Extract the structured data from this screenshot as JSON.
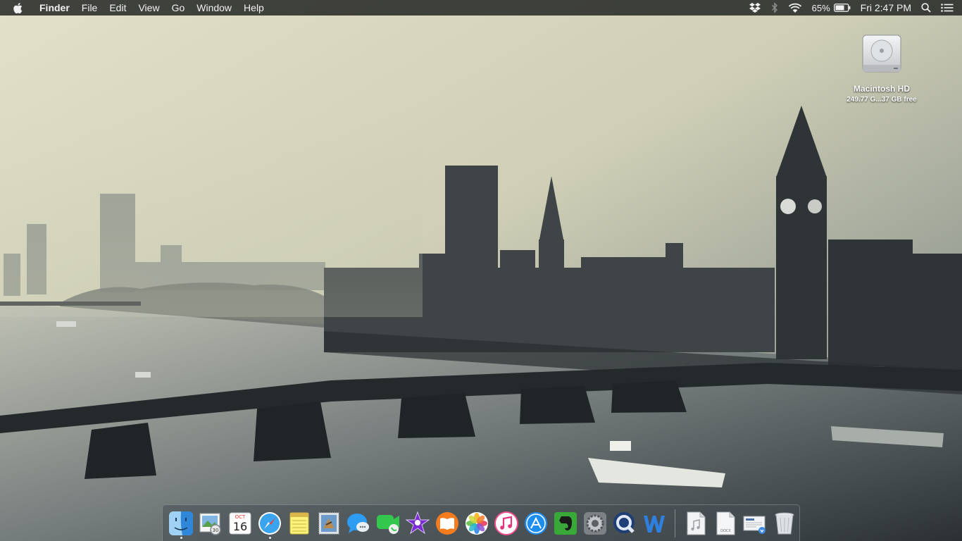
{
  "menubar": {
    "app_name": "Finder",
    "menus": [
      "File",
      "Edit",
      "View",
      "Go",
      "Window",
      "Help"
    ],
    "battery_percent": "65%",
    "clock": "Fri 2:47 PM",
    "status_icons": [
      "dropbox-icon",
      "bluetooth-icon",
      "wifi-icon",
      "battery-icon",
      "spotlight-icon",
      "notification-center-icon"
    ]
  },
  "desktop": {
    "hd_name": "Macintosh HD",
    "hd_subtitle": "249.77 G...37 GB free"
  },
  "dock": {
    "apps": [
      {
        "icon": "finder-icon",
        "running": true
      },
      {
        "icon": "preview-icon",
        "running": false
      },
      {
        "icon": "calendar-icon",
        "running": false,
        "month": "OCT",
        "day": "16"
      },
      {
        "icon": "safari-icon",
        "running": true
      },
      {
        "icon": "notes-icon",
        "running": false
      },
      {
        "icon": "mail-stamp-icon",
        "running": false
      },
      {
        "icon": "messages-icon",
        "running": false
      },
      {
        "icon": "facetime-icon",
        "running": false
      },
      {
        "icon": "imovie-icon",
        "running": false
      },
      {
        "icon": "ibooks-icon",
        "running": false
      },
      {
        "icon": "photos-icon",
        "running": false
      },
      {
        "icon": "itunes-icon",
        "running": false
      },
      {
        "icon": "app-store-icon",
        "running": false
      },
      {
        "icon": "evernote-icon",
        "running": false
      },
      {
        "icon": "system-preferences-icon",
        "running": false
      },
      {
        "icon": "quicktime-icon",
        "running": false
      },
      {
        "icon": "word-icon",
        "running": false
      }
    ],
    "documents": [
      {
        "icon": "audio-file-icon"
      },
      {
        "icon": "docx-file-icon",
        "label": "DOCX"
      },
      {
        "icon": "downloads-stack-icon"
      },
      {
        "icon": "trash-icon"
      }
    ]
  },
  "colors": {
    "menubar_bg": "#1c1e1e",
    "sky_top": "#d7d7bd",
    "river": "#5f6668"
  }
}
